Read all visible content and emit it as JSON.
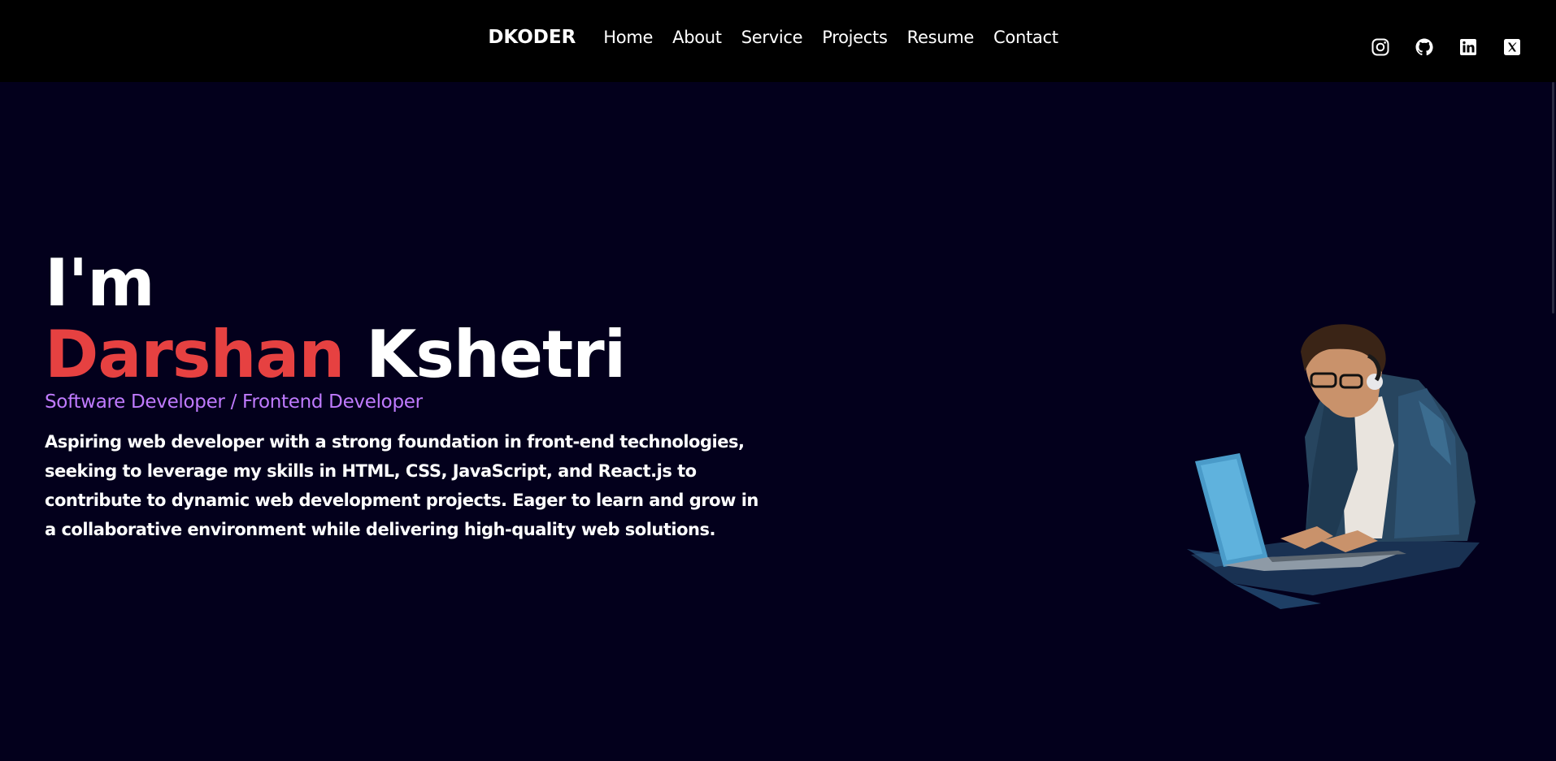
{
  "nav": {
    "brand": "DKODER",
    "links": [
      "Home",
      "About",
      "Service",
      "Projects",
      "Resume",
      "Contact"
    ],
    "social": [
      "instagram-icon",
      "github-icon",
      "linkedin-icon",
      "x-icon"
    ]
  },
  "hero": {
    "greeting": "I'm",
    "first_name": "Darshan",
    "last_name": "Kshetri",
    "role": "Software Developer / Frontend Developer",
    "bio": "Aspiring web developer with a strong foundation in front-end technologies, seeking to leverage my skills in HTML, CSS, JavaScript, and React.js to contribute to dynamic web development projects. Eager to learn and grow in a collaborative environment while delivering high-quality web solutions."
  },
  "colors": {
    "background": "#03001c",
    "navbar": "#000000",
    "accent_red": "#e64141",
    "accent_purple": "#c07bff",
    "text": "#ffffff"
  }
}
